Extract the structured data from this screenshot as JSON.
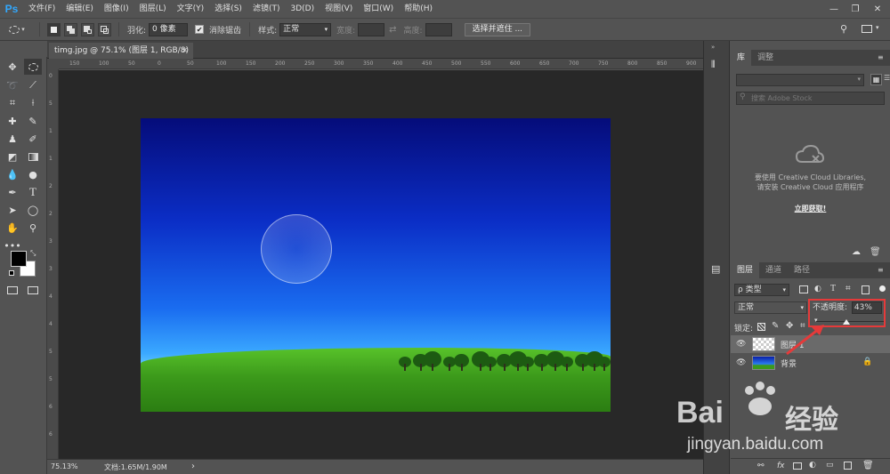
{
  "app": {
    "logo": "Ps"
  },
  "menu": [
    "文件(F)",
    "编辑(E)",
    "图像(I)",
    "图层(L)",
    "文字(Y)",
    "选择(S)",
    "滤镜(T)",
    "3D(D)",
    "视图(V)",
    "窗口(W)",
    "帮助(H)"
  ],
  "options": {
    "feather_label": "羽化:",
    "feather_value": "0 像素",
    "antialias_label": "消除锯齿",
    "style_label": "样式:",
    "style_value": "正常",
    "width_label": "宽度:",
    "height_label": "高度:",
    "select_mask_button": "选择并遮住 ..."
  },
  "document": {
    "tab_title": "timg.jpg @ 75.1% (图层 1, RGB/8) *",
    "ruler_h": [
      "150",
      "100",
      "50",
      "0",
      "50",
      "100",
      "150",
      "200",
      "250",
      "300",
      "350",
      "400",
      "450",
      "500",
      "550",
      "600",
      "650",
      "700",
      "750",
      "800",
      "850",
      "900",
      "950"
    ],
    "ruler_v": [
      "0",
      "5",
      "1",
      "1",
      "2",
      "2",
      "3",
      "3",
      "4",
      "4",
      "5",
      "5",
      "6",
      "6"
    ]
  },
  "status": {
    "zoom": "75.13%",
    "doc_info": "文档:1.65M/1.90M",
    "arrow": "›"
  },
  "library_panel": {
    "tabs": [
      "库",
      "调整"
    ],
    "search_placeholder": "搜索 Adobe Stock",
    "message_line1": "要使用 Creative Cloud Libraries,",
    "message_line2": "请安装 Creative Cloud 应用程序",
    "link": "立即获取!"
  },
  "layers_panel": {
    "tabs": [
      "图层",
      "通道",
      "路径"
    ],
    "filter_label": "ρ 类型",
    "blend_mode": "正常",
    "opacity_label": "不透明度:",
    "opacity_value": "43%",
    "lock_label": "锁定:",
    "layers": [
      {
        "name": "图层 1"
      },
      {
        "name": "背景"
      }
    ],
    "bottom_icons": [
      "link-icon",
      "fx-icon",
      "mask-icon",
      "adjustment-icon",
      "folder-icon",
      "new-layer-icon",
      "trash-icon"
    ],
    "fx_label": "fx"
  },
  "watermark": {
    "brand": "Bai",
    "brand_cn": "经验",
    "url": "jingyan.baidu.com"
  },
  "colors": {
    "highlight": "#e53a3a",
    "accent": "#31a8ff"
  }
}
